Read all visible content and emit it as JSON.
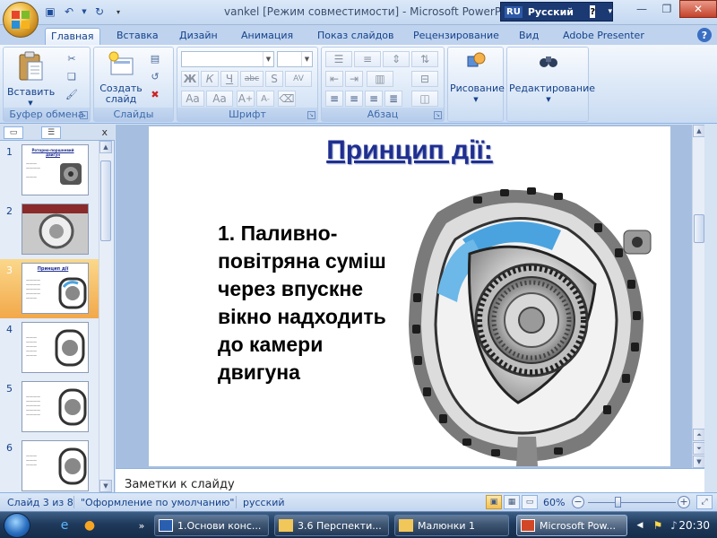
{
  "window": {
    "title": "vankel [Режим совместимости] - Microsoft PowerPoint",
    "lang_code": "RU",
    "lang_name": "Русский"
  },
  "tabs": [
    "Главная",
    "Вставка",
    "Дизайн",
    "Анимация",
    "Показ слайдов",
    "Рецензирование",
    "Вид",
    "Adobe Presenter"
  ],
  "ribbon": {
    "clipboard": {
      "paste": "Вставить",
      "label": "Буфер обмена"
    },
    "slides": {
      "create_line1": "Создать",
      "create_line2": "слайд",
      "label": "Слайды"
    },
    "font": {
      "label": "Шрифт"
    },
    "paragraph": {
      "label": "Абзац"
    },
    "drawing": {
      "label": "Рисование"
    },
    "editing": {
      "label": "Редактирование"
    }
  },
  "slide": {
    "title": "Принцип дії:",
    "body": "1. Паливно-повітряна суміш через впускне вікно надходить до камери двигуна"
  },
  "thumbnails": [
    {
      "num": "1",
      "title": "Роторно-поршневий двигун",
      "selected": false
    },
    {
      "num": "2",
      "title": "",
      "selected": false
    },
    {
      "num": "3",
      "title": "Принцип дії",
      "selected": true
    },
    {
      "num": "4",
      "title": "",
      "selected": false
    },
    {
      "num": "5",
      "title": "",
      "selected": false
    },
    {
      "num": "6",
      "title": "",
      "selected": false
    }
  ],
  "notes": {
    "placeholder": "Заметки к слайду"
  },
  "status": {
    "slide_info": "Слайд 3 из 8",
    "theme": "\"Оформление по умолчанию\"",
    "language": "русский",
    "zoom": "60%",
    "zoom_fraction": 0.35
  },
  "taskbar": {
    "tasks": [
      "1.Основи конс...",
      "3.6 Перспекти...",
      "Малюнки 1",
      "Microsoft Pow..."
    ],
    "clock": "20:30"
  },
  "colors": {
    "accent": "#15428b",
    "slide_title": "#1f2f90",
    "selected_thumb": "#f2a84a"
  }
}
